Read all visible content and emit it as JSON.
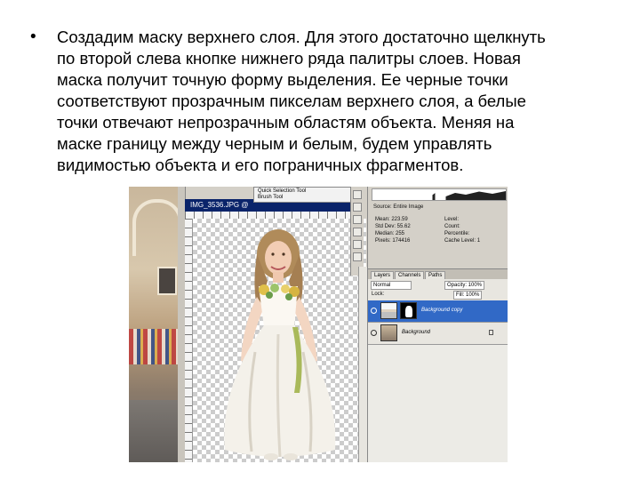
{
  "slide": {
    "bullet": "•",
    "text": "Создадим маску верхнего слоя. Для этого достаточно щелкнуть\nпо второй слева кнопке нижнего ряда палитры слоев. Новая\nмаска получит точную форму выделения. Ее черные точки\nсоответствуют прозрачным пикселам верхнего слоя, а белые\nточки отвечают непрозрачным областям объекта. Меняя на\nмаске границу между черным и белым, будем управлять\nвидимостью объекта и его пограничных фрагментов."
  },
  "screenshot": {
    "doc_title": "IMG_3536.JPG @",
    "tool_popup": [
      "Quick Selection Tool",
      "Brush Tool"
    ],
    "histogram": {
      "source_label": "Source: Entire Image",
      "stats_left": [
        "Mean: 223.59",
        "Std Dev: 55.62",
        "Median: 255",
        "Pixels: 174416"
      ],
      "stats_right": [
        "Level:",
        "Count:",
        "Percentile:",
        "Cache Level: 1"
      ]
    },
    "layers_tabs": [
      "Layers",
      "Channels",
      "Paths"
    ],
    "blend_mode": "Normal",
    "opacity": "Opacity: 100%",
    "lock_label": "Lock:",
    "fill": "Fill: 100%",
    "layers": [
      {
        "name": "Background copy"
      },
      {
        "name": "Background"
      }
    ]
  }
}
